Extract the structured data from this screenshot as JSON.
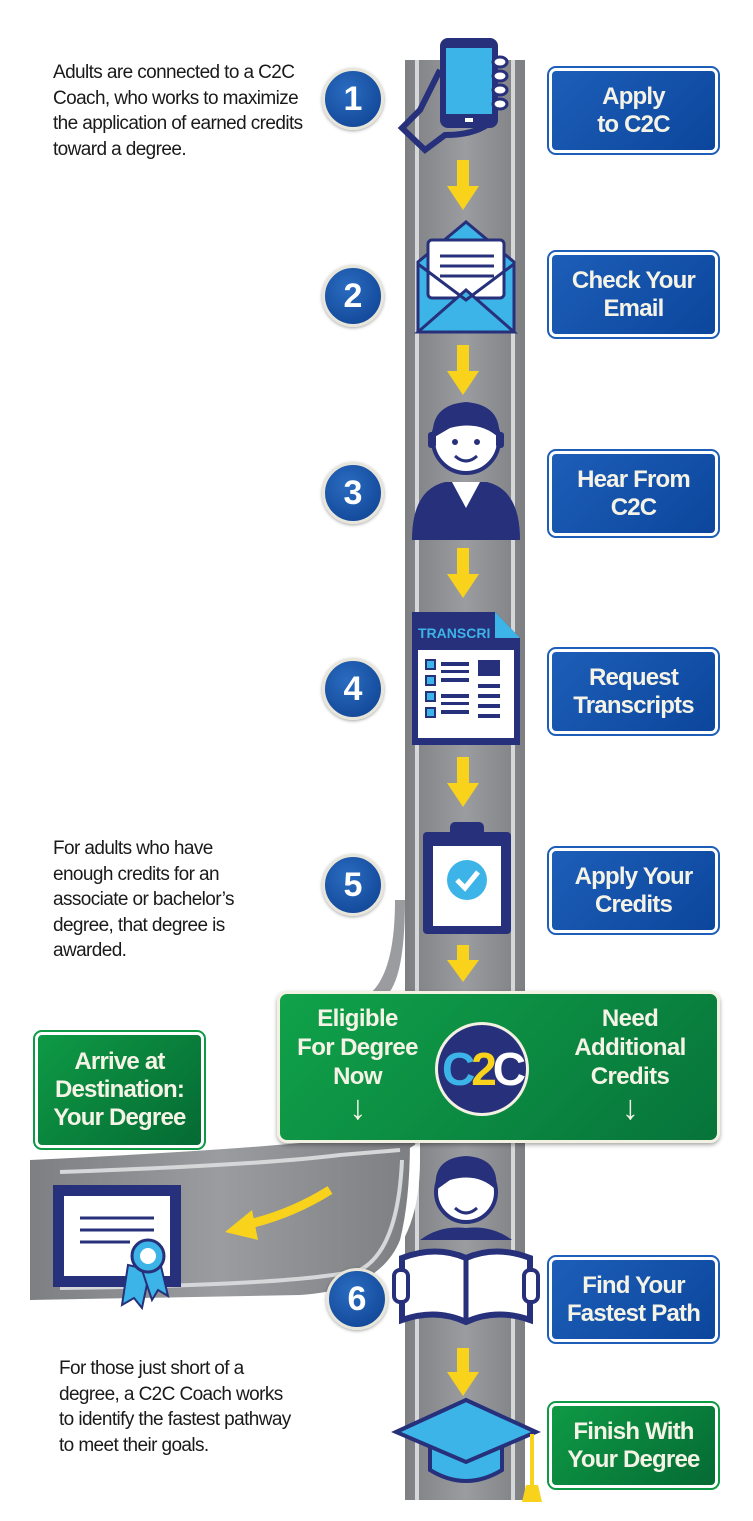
{
  "paragraphs": {
    "top": "Adults are connected to a C2C Coach, who works to maximize the application of earned credits toward a degree.",
    "middle": "For adults who have enough credits for an associate or bachelor’s degree, that degree is awarded.",
    "bottom": "For those just short of a degree, a C2C Coach works to identify the fastest pathway to meet their goals."
  },
  "steps": [
    {
      "number": "1",
      "label_l1": "Apply",
      "label_l2": "to C2C",
      "icon": "phone-in-hand-icon"
    },
    {
      "number": "2",
      "label_l1": "Check Your",
      "label_l2": "Email",
      "icon": "envelope-icon"
    },
    {
      "number": "3",
      "label_l1": "Hear From",
      "label_l2": "C2C",
      "icon": "coach-person-icon"
    },
    {
      "number": "4",
      "label_l1": "Request",
      "label_l2": "Transcripts",
      "icon": "transcript-document-icon",
      "icon_text": "TRANSCRI"
    },
    {
      "number": "5",
      "label_l1": "Apply Your",
      "label_l2": "Credits",
      "icon": "clipboard-check-icon"
    },
    {
      "number": "6",
      "label_l1": "Find Your",
      "label_l2": "Fastest Path",
      "icon": "person-reading-book-icon"
    }
  ],
  "finish": {
    "label_l1": "Finish With",
    "label_l2": "Your Degree",
    "icon": "graduation-cap-icon"
  },
  "junction": {
    "left_l1": "Eligible",
    "left_l2": "For Degree",
    "left_l3": "Now",
    "right_l1": "Need",
    "right_l2": "Additional",
    "right_l3": "Credits",
    "logo": "C2C"
  },
  "destination": {
    "label_l1": "Arrive at",
    "label_l2": "Destination:",
    "label_l3": "Your Degree",
    "icon": "diploma-certificate-icon"
  },
  "colors": {
    "blue_sign": "#1557ae",
    "green_sign": "#0e9a45",
    "road": "#8a8c90",
    "arrow": "#f9d21c",
    "navy": "#27307a",
    "light_blue": "#3db4e8"
  }
}
